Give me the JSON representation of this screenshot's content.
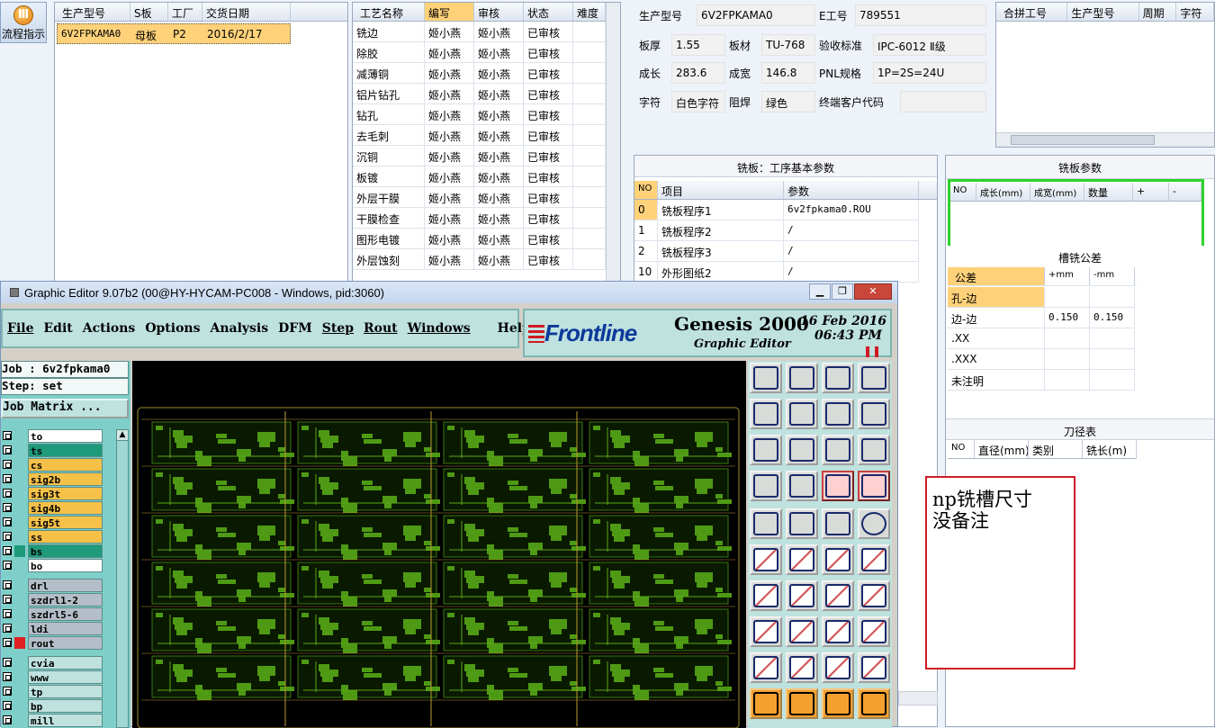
{
  "left_button": {
    "label": "流程指示"
  },
  "order_table": {
    "headers": [
      "生产型号",
      "S板",
      "工厂",
      "交货日期"
    ],
    "rows": [
      [
        "6V2FPKAMA0",
        "母板",
        "P2",
        "2016/2/17"
      ]
    ]
  },
  "process_table": {
    "headers": [
      "工艺名称",
      "编写",
      "审核",
      "状态",
      "难度"
    ],
    "rows": [
      [
        "铣边",
        "姬小燕",
        "姬小燕",
        "已审核",
        ""
      ],
      [
        "除胶",
        "姬小燕",
        "姬小燕",
        "已审核",
        ""
      ],
      [
        "减薄铜",
        "姬小燕",
        "姬小燕",
        "已审核",
        ""
      ],
      [
        "铝片钻孔",
        "姬小燕",
        "姬小燕",
        "已审核",
        ""
      ],
      [
        "钻孔",
        "姬小燕",
        "姬小燕",
        "已审核",
        ""
      ],
      [
        "去毛刺",
        "姬小燕",
        "姬小燕",
        "已审核",
        ""
      ],
      [
        "沉铜",
        "姬小燕",
        "姬小燕",
        "已审核",
        ""
      ],
      [
        "板镀",
        "姬小燕",
        "姬小燕",
        "已审核",
        ""
      ],
      [
        "外层干膜",
        "姬小燕",
        "姬小燕",
        "已审核",
        ""
      ],
      [
        "干膜检查",
        "姬小燕",
        "姬小燕",
        "已审核",
        ""
      ],
      [
        "图形电镀",
        "姬小燕",
        "姬小燕",
        "已审核",
        ""
      ],
      [
        "外层蚀刻",
        "姬小燕",
        "姬小燕",
        "已审核",
        ""
      ]
    ]
  },
  "product_info": {
    "model_label": "生产型号",
    "model": "6V2FPKAMA0",
    "eno_label": "E工号",
    "eno": "789551",
    "thick_label": "板厚",
    "thick": "1.55",
    "mat_label": "板材",
    "mat": "TU-768",
    "std_label": "验收标准",
    "std": "IPC-6012 Ⅱ级",
    "len_label": "成长",
    "len": "283.6",
    "wid_label": "成宽",
    "wid": "146.8",
    "pnl_label": "PNL规格",
    "pnl": "1P=2S=24U",
    "char_label": "字符",
    "char": "白色字符",
    "mask_label": "阻焊",
    "mask": "绿色",
    "cust_label": "终端客户代码",
    "cust": ""
  },
  "combine_table": {
    "headers": [
      "合拼工号",
      "生产型号",
      "周期",
      "字符"
    ]
  },
  "mill_basic": {
    "title": "铣板：工序基本参数",
    "headers": [
      "NO",
      "项目",
      "参数"
    ],
    "rows": [
      [
        "0",
        "铣板程序1",
        "6v2fpkama0.ROU"
      ],
      [
        "1",
        "铣板程序2",
        "/"
      ],
      [
        "2",
        "铣板程序3",
        "/"
      ],
      [
        "10",
        "外形图纸2",
        "/"
      ]
    ]
  },
  "mill_params": {
    "title": "铣板参数",
    "headers": [
      "NO",
      "成长(mm)",
      "成宽(mm)",
      "数量",
      "+",
      "-"
    ]
  },
  "slot_tol": {
    "title": "槽铣公差",
    "headers": [
      "公差",
      "+mm",
      "-mm"
    ],
    "rows": [
      [
        "孔-边",
        "",
        ""
      ],
      [
        "边-边",
        "0.150",
        "0.150"
      ],
      [
        ".XX",
        "",
        ""
      ],
      [
        ".XXX",
        "",
        ""
      ],
      [
        "未注明",
        "",
        ""
      ]
    ]
  },
  "tool_table": {
    "title": "刀径表",
    "headers": [
      "NO",
      "直径(mm)",
      "类别",
      "铣长(m)"
    ]
  },
  "genesis": {
    "title": "Graphic Editor 9.07b2 (00@HY-HYCAM-PC008 - Windows, pid:3060)",
    "menus": [
      "File",
      "Edit",
      "Actions",
      "Options",
      "Analysis",
      "DFM",
      "Step",
      "Rout",
      "Windows",
      "Help"
    ],
    "brand": "Frontline",
    "product": "Genesis 2000",
    "subtitle": "Graphic Editor",
    "date": "16 Feb 2016",
    "time": "06:43 PM",
    "job_label": "Job : 6v2fpkama0",
    "step_label": "Step: set",
    "job_matrix": "Job Matrix ...",
    "layers": [
      {
        "name": "to",
        "color": "#ffffff",
        "mark": ""
      },
      {
        "name": "ts",
        "color": "#1f9a7a",
        "mark": ""
      },
      {
        "name": "cs",
        "color": "#f6c149",
        "mark": ""
      },
      {
        "name": "sig2b",
        "color": "#f6c149",
        "mark": ""
      },
      {
        "name": "sig3t",
        "color": "#f6c149",
        "mark": ""
      },
      {
        "name": "sig4b",
        "color": "#f6c149",
        "mark": ""
      },
      {
        "name": "sig5t",
        "color": "#f6c149",
        "mark": ""
      },
      {
        "name": "ss",
        "color": "#f6c149",
        "mark": ""
      },
      {
        "name": "bs",
        "color": "#1f9a7a",
        "mark": "#1f9a7a"
      },
      {
        "name": "bo",
        "color": "#ffffff",
        "mark": ""
      },
      {
        "name": "drl",
        "color": "#b4bec8",
        "mark": ""
      },
      {
        "name": "szdrl1-2",
        "color": "#b4bec8",
        "mark": ""
      },
      {
        "name": "szdrl5-6",
        "color": "#b4bec8",
        "mark": ""
      },
      {
        "name": "ldi",
        "color": "#b4bec8",
        "mark": ""
      },
      {
        "name": "rout",
        "color": "#b4bec8",
        "mark": "#e02020"
      },
      {
        "name": "cvia",
        "color": "#bfe2df",
        "mark": ""
      },
      {
        "name": "www",
        "color": "#bfe2df",
        "mark": ""
      },
      {
        "name": "tp",
        "color": "#bfe2df",
        "mark": ""
      },
      {
        "name": "bp",
        "color": "#bfe2df",
        "mark": ""
      },
      {
        "name": "mill",
        "color": "#bfe2df",
        "mark": ""
      }
    ]
  },
  "annotation": {
    "line1": "np铣槽尺寸",
    "line2": "没备注"
  }
}
